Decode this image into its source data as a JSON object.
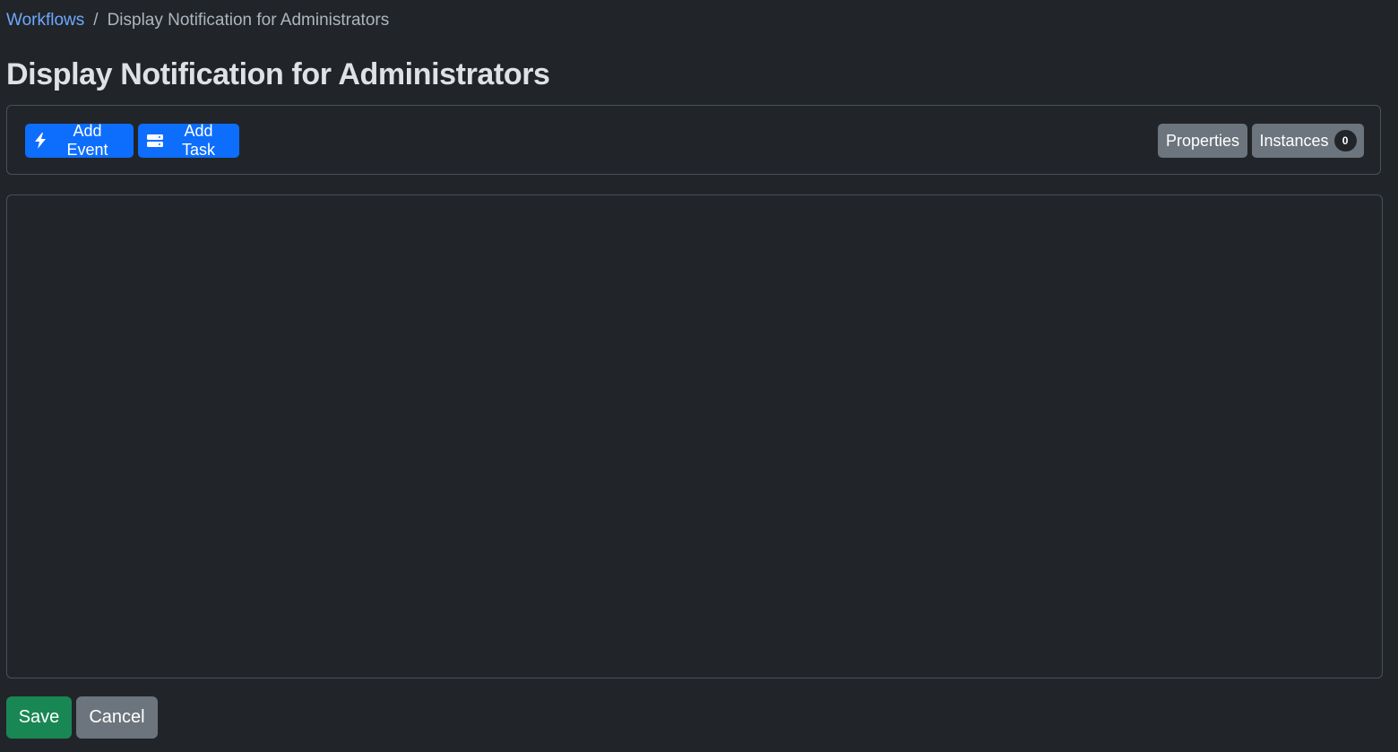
{
  "breadcrumb": {
    "parent": "Workflows",
    "separator": "/",
    "current": "Display Notification for Administrators"
  },
  "page": {
    "title": "Display Notification for Administrators"
  },
  "toolbar": {
    "add_event": {
      "label": "Add Event",
      "icon": "lightning-bolt-icon"
    },
    "add_task": {
      "label": "Add Task",
      "icon": "server-stack-icon"
    },
    "properties": {
      "label": "Properties"
    },
    "instances": {
      "label": "Instances",
      "count": "0"
    }
  },
  "footer": {
    "save": "Save",
    "cancel": "Cancel"
  },
  "colors": {
    "background": "#212529",
    "primary": "#0d6efd",
    "secondary": "#6c757d",
    "success": "#198754",
    "link": "#6ea8fe",
    "border": "#495057"
  }
}
